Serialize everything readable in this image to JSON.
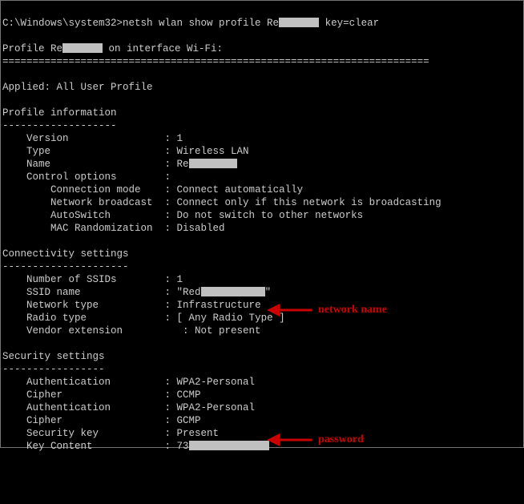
{
  "prompt_prefix": "C:\\Windows\\system32>",
  "command_part1": "netsh wlan show profile Re",
  "command_part2": " key=clear",
  "header_part1": "Profile Re",
  "header_part2": " on interface Wi-Fi:",
  "divider": "=======================================================================",
  "applied_line": "Applied: All User Profile",
  "section_profile": "Profile information",
  "section_connectivity": "Connectivity settings",
  "section_security": "Security settings",
  "dashes": "-------------------",
  "dashes2": "---------------------",
  "dashes3": "-----------------",
  "profile": {
    "version_k": "    Version                : ",
    "version_v": "1",
    "type_k": "    Type                   : ",
    "type_v": "Wireless LAN",
    "name_k": "    Name                   : ",
    "name_v": "Re",
    "ctrl_k": "    Control options        :",
    "conn_k": "        Connection mode    : ",
    "conn_v": "Connect automatically",
    "bcast_k": "        Network broadcast  : ",
    "bcast_v": "Connect only if this network is broadcasting",
    "auto_k": "        AutoSwitch         : ",
    "auto_v": "Do not switch to other networks",
    "mac_k": "        MAC Randomization  : ",
    "mac_v": "Disabled"
  },
  "conn": {
    "num_k": "    Number of SSIDs        : ",
    "num_v": "1",
    "ssid_k": "    SSID name              : ",
    "ssid_v1": "\"Red",
    "ssid_v2": "\"",
    "ntype_k": "    Network type           : ",
    "ntype_v": "Infrastructure",
    "rtype_k": "    Radio type             : ",
    "rtype_v": "[ Any Radio Type ]",
    "vend_k": "    Vendor extension          : ",
    "vend_v": "Not present"
  },
  "sec": {
    "auth1_k": "    Authentication         : ",
    "auth1_v": "WPA2-Personal",
    "ciph1_k": "    Cipher                 : ",
    "ciph1_v": "CCMP",
    "auth2_k": "    Authentication         : ",
    "auth2_v": "WPA2-Personal",
    "ciph2_k": "    Cipher                 : ",
    "ciph2_v": "GCMP",
    "skey_k": "    Security key           : ",
    "skey_v": "Present",
    "kcon_k": "    Key Content            : ",
    "kcon_v": "73"
  },
  "annotations": {
    "network_name": "network name",
    "password": "password"
  }
}
